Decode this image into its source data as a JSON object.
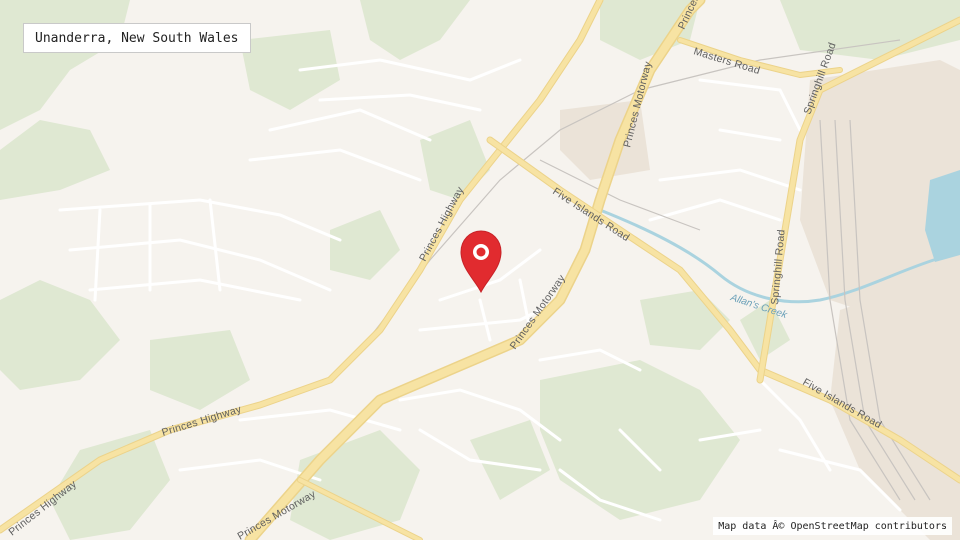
{
  "location_label": "Unanderra, New South Wales",
  "attribution": "Map data Â© OpenStreetMap contributors",
  "colors": {
    "land": "#f6f3ee",
    "park": "#dfe8d2",
    "major_road": "#f7e3a3",
    "major_road_edge": "#ecd38a",
    "minor_road": "#ffffff",
    "water": "#aad3df",
    "marker": "#e12b2f",
    "industrial": "#ebe3d8"
  },
  "roads": {
    "princes_highway_north": "Princes Highway",
    "princes_highway_south": "Princes Highway",
    "princes_highway_sw": "Princes Highway",
    "princes_motorway_center": "Princes Motorway",
    "princes_motorway_north": "Princes Motorway",
    "princes_motorway_sw": "Princes Motorway",
    "five_islands_road_north": "Five Islands Road",
    "five_islands_road_east": "Five Islands Road",
    "masters_road": "Masters Road",
    "springhill_road_north": "Springhill Road",
    "springhill_road_center": "Springhill Road",
    "princes_top": "Princes"
  },
  "waterways": {
    "allans_creek": "Allan's Creek"
  },
  "icons": {
    "marker": "map-pin-icon"
  }
}
